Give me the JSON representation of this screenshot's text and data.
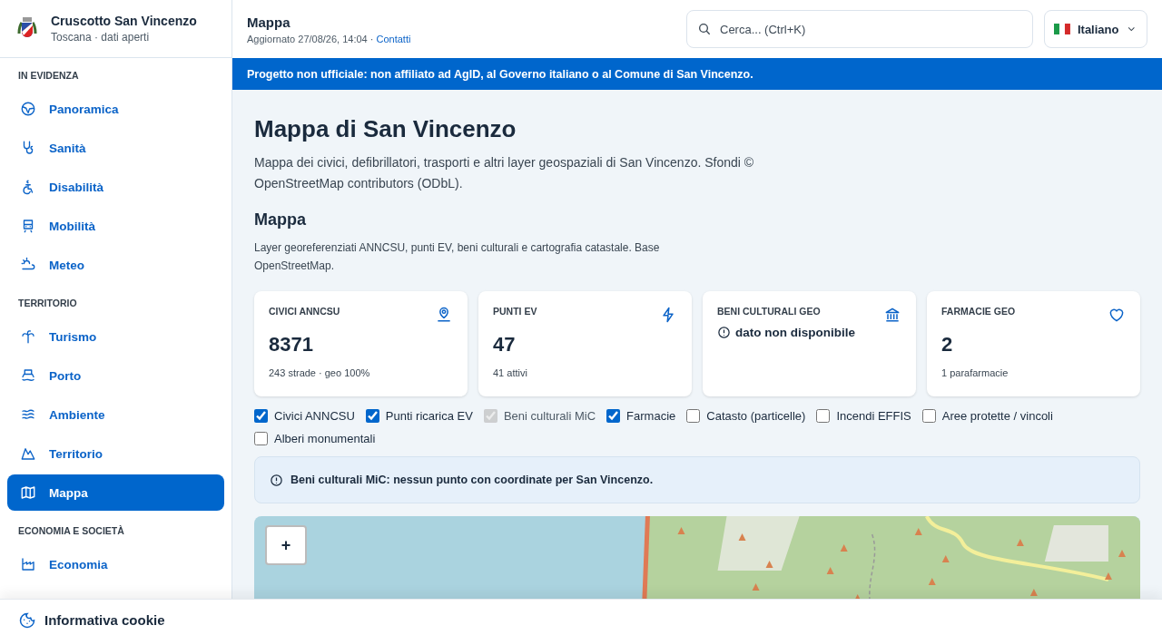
{
  "brand": {
    "title": "Cruscotto San Vincenzo",
    "subtitle": "Toscana · dati aperti"
  },
  "header": {
    "title": "Mappa",
    "updated": "Aggiornato 27/08/26, 14:04 · ",
    "contact_link": "Contatti"
  },
  "search": {
    "placeholder": "Cerca... (Ctrl+K)"
  },
  "language": {
    "label": "Italiano"
  },
  "banner": "Progetto non ufficiale: non affiliato ad AgID, al Governo italiano o al Comune di San Vincenzo.",
  "sidebar": {
    "sections": [
      {
        "title": "IN EVIDENZA",
        "items": [
          {
            "label": "Panoramica",
            "selected": false
          },
          {
            "label": "Sanità",
            "selected": false
          },
          {
            "label": "Disabilità",
            "selected": false
          },
          {
            "label": "Mobilità",
            "selected": false
          },
          {
            "label": "Meteo",
            "selected": false
          }
        ]
      },
      {
        "title": "TERRITORIO",
        "items": [
          {
            "label": "Turismo",
            "selected": false
          },
          {
            "label": "Porto",
            "selected": false
          },
          {
            "label": "Ambiente",
            "selected": false
          },
          {
            "label": "Territorio",
            "selected": false
          },
          {
            "label": "Mappa",
            "selected": true
          }
        ]
      },
      {
        "title": "ECONOMIA E SOCIETÀ",
        "items": [
          {
            "label": "Economia",
            "selected": false
          }
        ]
      }
    ]
  },
  "page": {
    "title": "Mappa di San Vincenzo",
    "description": "Mappa dei civici, defibrillatori, trasporti e altri layer geospaziali di San Vincenzo. Sfondi © OpenStreetMap contributors (ODbL).",
    "section_title": "Mappa",
    "section_description": "Layer georeferenziati ANNCSU, punti EV, beni culturali e cartografia catastale. Base OpenStreetMap."
  },
  "cards": [
    {
      "kind": "value",
      "label": "CIVICI ANNCSU",
      "value": "8371",
      "note": "243 strade · geo 100%"
    },
    {
      "kind": "value",
      "label": "PUNTI EV",
      "value": "47",
      "note": "41 attivi"
    },
    {
      "kind": "unavailable",
      "label": "BENI CULTURALI GEO",
      "value": "dato non disponibile"
    },
    {
      "kind": "value",
      "label": "FARMACIE GEO",
      "value": "2",
      "note": "1 parafarmacie"
    }
  ],
  "layers": [
    {
      "label": "Civici ANNCSU",
      "checked": true,
      "disabled": false
    },
    {
      "label": "Punti ricarica EV",
      "checked": true,
      "disabled": false
    },
    {
      "label": "Beni culturali MiC",
      "checked": true,
      "disabled": true
    },
    {
      "label": "Farmacie",
      "checked": true,
      "disabled": false
    },
    {
      "label": "Catasto (particelle)",
      "checked": false,
      "disabled": false
    },
    {
      "label": "Incendi EFFIS",
      "checked": false,
      "disabled": false
    },
    {
      "label": "Aree protette / vincoli",
      "checked": false,
      "disabled": false
    },
    {
      "label": "Alberi monumentali",
      "checked": false,
      "disabled": false
    }
  ],
  "notice": "Beni culturali MiC: nessun punto con coordinate per San Vincenzo.",
  "map": {
    "kind": "picture",
    "zoom_in": "+"
  },
  "cookie_bar": {
    "title": "Informativa cookie"
  }
}
